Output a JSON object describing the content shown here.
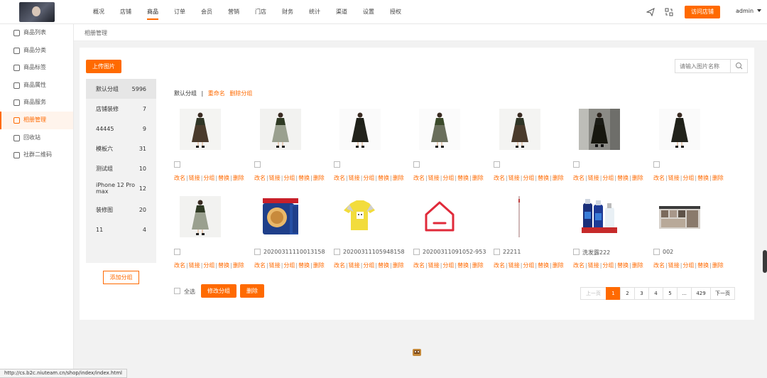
{
  "topnav": {
    "items": [
      "概况",
      "店铺",
      "商品",
      "订单",
      "会员",
      "营销",
      "门店",
      "财务",
      "统计",
      "渠道",
      "设置",
      "授权"
    ],
    "active_index": 2,
    "visit_store_label": "访问店铺",
    "admin_label": "admin"
  },
  "sidebar": {
    "items": [
      "商品列表",
      "商品分类",
      "商品标签",
      "商品属性",
      "商品服务",
      "相册管理",
      "回收站",
      "社群二维码"
    ],
    "active_index": 5
  },
  "breadcrumb": "相册管理",
  "toolbar": {
    "upload_label": "上传图片",
    "search_placeholder": "请输入图片名称"
  },
  "groups": [
    {
      "name": "默认分组",
      "count": "5996"
    },
    {
      "name": "店铺装修",
      "count": "7"
    },
    {
      "name": "44445",
      "count": "9"
    },
    {
      "name": "模板六",
      "count": "31"
    },
    {
      "name": "测试组",
      "count": "10"
    },
    {
      "name": "iPhone 12 Pro max",
      "count": "12"
    },
    {
      "name": "装修图",
      "count": "20"
    },
    {
      "name": "11",
      "count": "4"
    }
  ],
  "add_group_label": "添加分组",
  "group_actions": {
    "current": "默认分组",
    "separator": "|",
    "rename": "重命名",
    "delete": "删除分组"
  },
  "image_ops": [
    "改名",
    "链接",
    "分组",
    "替换",
    "删除"
  ],
  "images": [
    {
      "name": "",
      "kind": "dress-plaid"
    },
    {
      "name": "",
      "kind": "dress-gray"
    },
    {
      "name": "",
      "kind": "dress-black"
    },
    {
      "name": "",
      "kind": "dress-small"
    },
    {
      "name": "",
      "kind": "dress-plaid"
    },
    {
      "name": "",
      "kind": "dress-dark"
    },
    {
      "name": "",
      "kind": "dress-black"
    },
    {
      "name": "",
      "kind": "dress-gray"
    },
    {
      "name": "20200311110013158",
      "kind": "cookie-box"
    },
    {
      "name": "20200311105948158",
      "kind": "tshirt-yellow"
    },
    {
      "name": "20200311091052-953",
      "kind": "house-icon"
    },
    {
      "name": "22211",
      "kind": "thin-line"
    },
    {
      "name": "洗发露222",
      "kind": "shampoo"
    },
    {
      "name": "002",
      "kind": "store-shelf"
    }
  ],
  "bottom_actions": {
    "select_all": "全选",
    "modify_group": "修改分组",
    "delete": "删除"
  },
  "pagination": {
    "prev": "上一页",
    "pages": [
      "1",
      "2",
      "3",
      "4",
      "5",
      "...",
      "429"
    ],
    "current": "1",
    "next": "下一页"
  },
  "status_url": "http://cs.b2c.niuteam.cn/shop/index/index.html",
  "colors": {
    "accent": "#ff6a00"
  }
}
